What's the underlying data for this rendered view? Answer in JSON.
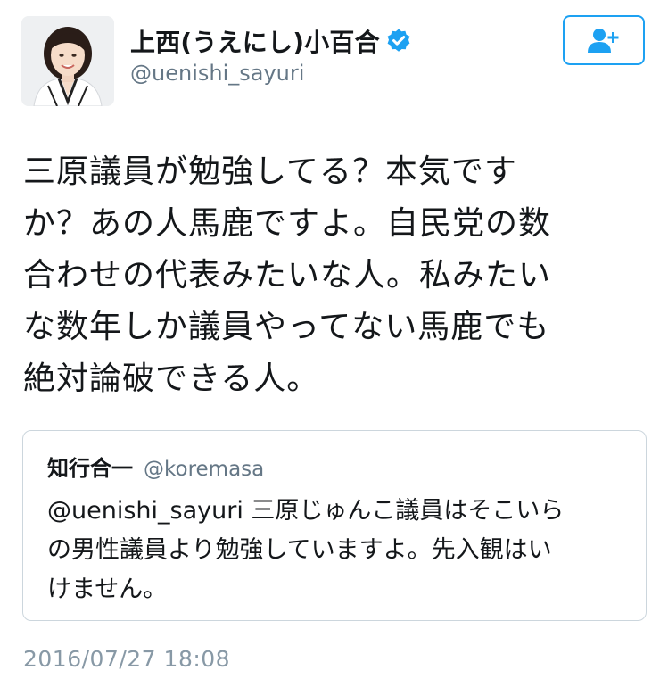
{
  "user": {
    "display_name": "上西(うえにし)小百合",
    "handle": "@uenishi_sayuri",
    "verified": true,
    "avatar_icon": "profile-photo"
  },
  "follow_button": {
    "icon": "add-user-icon",
    "color": "#1da1f2"
  },
  "tweet": {
    "text_lines": [
      "三原議員が勉強してる？本気です",
      "か？あの人馬鹿ですよ。自民党の数",
      "合わせの代表みたいな人。私みたい",
      "な数年しか議員やってない馬鹿でも",
      "絶対論破できる人。"
    ],
    "timestamp": "2016/07/27 18:08"
  },
  "quoted_tweet": {
    "display_name": "知行合一",
    "handle": "@koremasa",
    "text_lines": [
      "@uenishi_sayuri  三原じゅんこ議員はそこいら",
      "の男性議員より勉強していますよ。先入観はい",
      "けません。"
    ]
  },
  "colors": {
    "accent": "#1da1f2",
    "secondary_text": "#657786",
    "border": "#ccd6dd"
  }
}
